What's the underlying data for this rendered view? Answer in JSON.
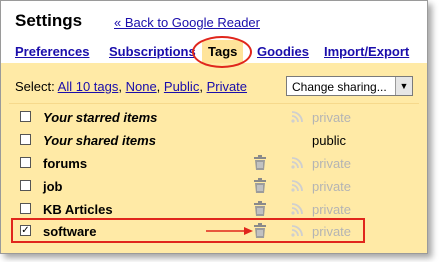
{
  "header": {
    "title": "Settings",
    "back_link": "« Back to Google Reader"
  },
  "tabs": [
    {
      "label": "Preferences",
      "active": false
    },
    {
      "label": "Subscriptions",
      "active": false
    },
    {
      "label": "Tags",
      "active": true
    },
    {
      "label": "Goodies",
      "active": false
    },
    {
      "label": "Import/Export",
      "active": false
    }
  ],
  "select_bar": {
    "prefix": "Select:",
    "all": "All 10 tags",
    "none": "None",
    "public": "Public",
    "private": "Private"
  },
  "sharing_dropdown": {
    "selected": "Change sharing..."
  },
  "tags": [
    {
      "name": "Your starred items",
      "italic": true,
      "checked": false,
      "deletable": false,
      "sharing": "private"
    },
    {
      "name": "Your shared items",
      "italic": true,
      "checked": false,
      "deletable": false,
      "sharing": "public"
    },
    {
      "name": "forums",
      "italic": false,
      "checked": false,
      "deletable": true,
      "sharing": "private"
    },
    {
      "name": "job",
      "italic": false,
      "checked": false,
      "deletable": true,
      "sharing": "private"
    },
    {
      "name": "KB Articles",
      "italic": false,
      "checked": false,
      "deletable": true,
      "sharing": "private"
    },
    {
      "name": "software",
      "italic": false,
      "checked": true,
      "deletable": true,
      "sharing": "private"
    }
  ],
  "icons": {
    "trash": "trash-icon",
    "feed": "feed-icon",
    "checkmark": "check-icon",
    "dropdown": "chevron-down-icon"
  },
  "colors": {
    "content_bg": "#ffeaa6",
    "active_tab_bg": "#ffe49a",
    "link": "#1a0dab",
    "highlight": "#e0261c",
    "disabled_text": "#b4b4b4"
  }
}
